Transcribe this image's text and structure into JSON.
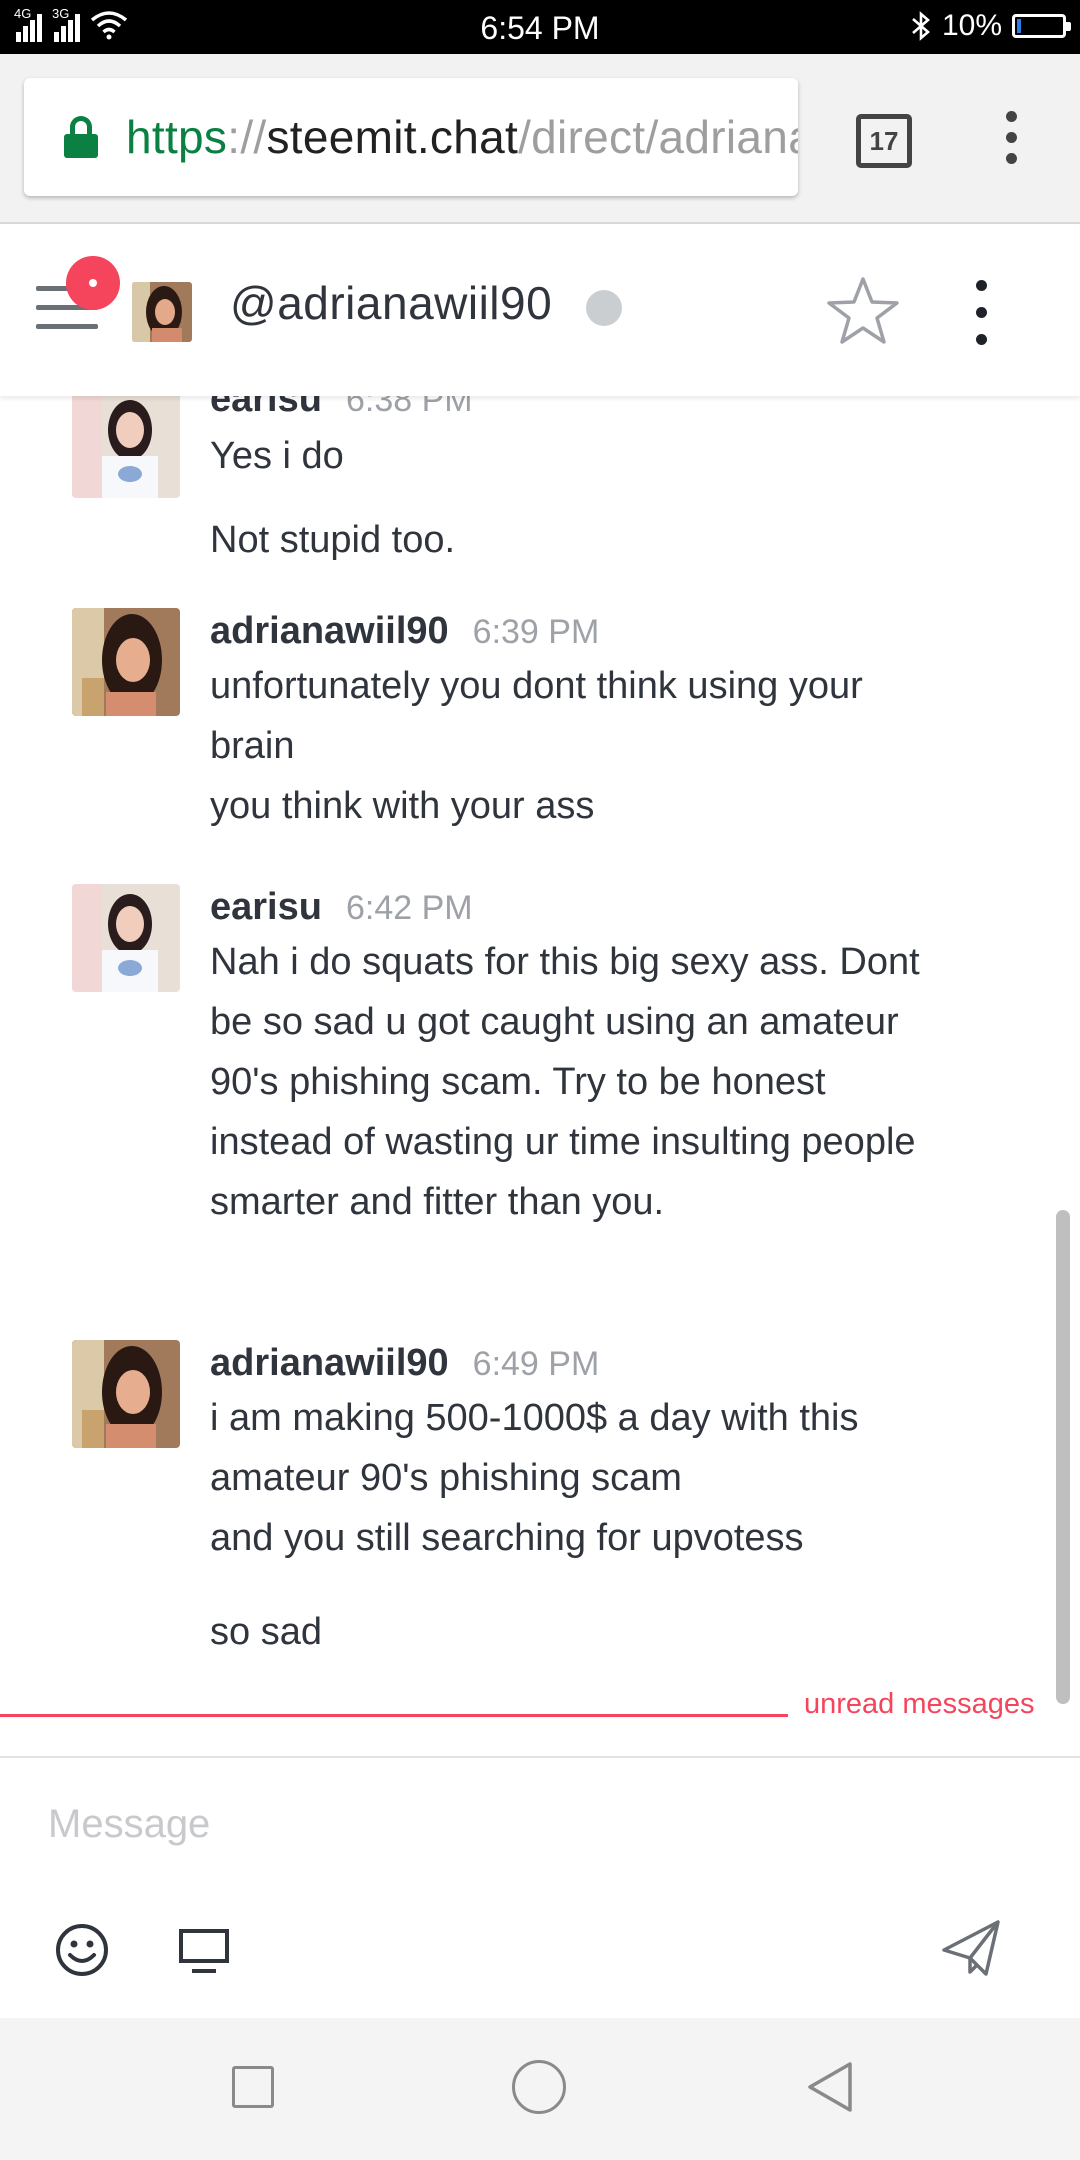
{
  "status_bar": {
    "network_1": "4G",
    "network_2": "3G",
    "time": "6:54 PM",
    "battery_text": "10%",
    "battery_level": 0.1
  },
  "browser": {
    "url_scheme": "https",
    "url_sep": "://",
    "url_host": "steemit.chat",
    "url_path": "/direct/adriana",
    "tab_count": "17"
  },
  "room": {
    "title": "@adrianawiil90"
  },
  "messages": [
    {
      "user": "earisu",
      "time": "6:38 PM",
      "lines": [
        "Yes i do"
      ]
    },
    {
      "user": "",
      "time": "",
      "lines": [
        "Not stupid too."
      ]
    },
    {
      "user": "adrianawiil90",
      "time": "6:39 PM",
      "lines": [
        "unfortunately you dont think using your brain",
        "you think with your ass"
      ]
    },
    {
      "user": "earisu",
      "time": "6:42 PM",
      "lines": [
        "Nah i do squats for this big sexy ass. Dont be so sad u got caught using an amateur 90's phishing scam. Try to be honest instead of wasting ur time insulting people smarter and fitter than you."
      ]
    },
    {
      "user": "adrianawiil90",
      "time": "6:49 PM",
      "lines": [
        "i am making 500-1000$ a day with this amateur 90's phishing scam",
        "and you still searching for upvotess"
      ]
    },
    {
      "user": "",
      "time": "",
      "lines": [
        "so sad"
      ]
    }
  ],
  "unread_label": "unread messages",
  "composer": {
    "placeholder": "Message"
  },
  "colors": {
    "accent_red": "#f5455c",
    "secure_green": "#0b8043"
  }
}
